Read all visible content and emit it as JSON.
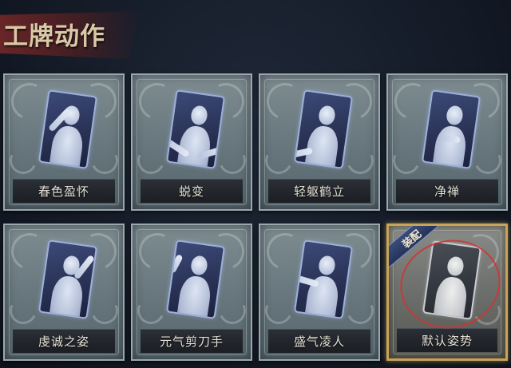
{
  "header": {
    "title": "工牌动作"
  },
  "colors": {
    "title_text": "#d9c9a6",
    "title_banner": "#782828",
    "card_frame": "#7f8d91",
    "equipped_border": "#c8a35a",
    "equip_ribbon": "#3a4c7a",
    "label_text": "#e6e2d8"
  },
  "cards": [
    {
      "label": "春色盈怀",
      "pose": "hand-raised-flower"
    },
    {
      "label": "蜕变",
      "pose": "arms-spread"
    },
    {
      "label": "轻躯鹤立",
      "pose": "arm-extended"
    },
    {
      "label": "净禅",
      "pose": "hands-folded"
    },
    {
      "label": "虔诚之姿",
      "pose": "arm-raised"
    },
    {
      "label": "元气剪刀手",
      "pose": "peace-sign"
    },
    {
      "label": "盛气凌人",
      "pose": "pointing"
    },
    {
      "label": "默认姿势",
      "pose": "default",
      "equipped": true,
      "badge": "装配"
    }
  ]
}
